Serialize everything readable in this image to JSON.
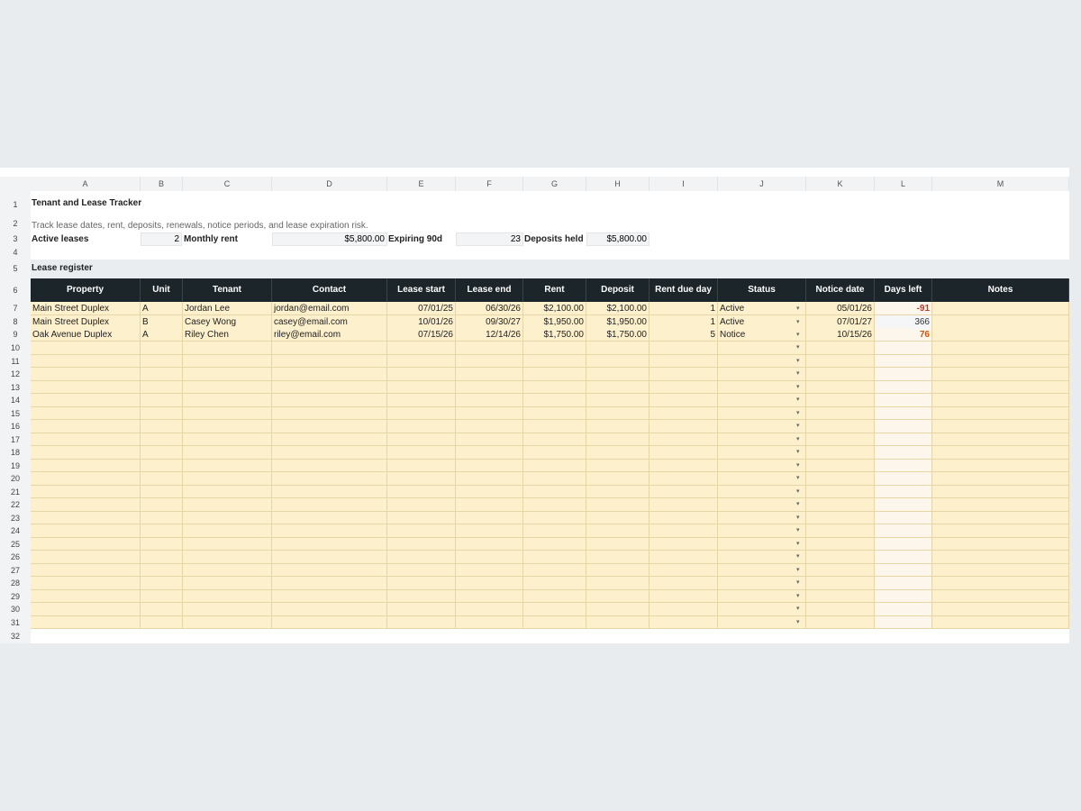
{
  "columns": [
    "A",
    "B",
    "C",
    "D",
    "E",
    "F",
    "G",
    "H",
    "I",
    "J",
    "K",
    "L",
    "M"
  ],
  "row_numbers": [
    "1",
    "2",
    "3",
    "4",
    "5",
    "6",
    "7",
    "8",
    "9",
    "10",
    "11",
    "12",
    "13",
    "14",
    "15",
    "16",
    "17",
    "18",
    "19",
    "20",
    "21",
    "22",
    "23",
    "24",
    "25",
    "26",
    "27",
    "28",
    "29",
    "30",
    "31",
    "32"
  ],
  "title": "Tenant and Lease Tracker",
  "subtitle": "Track lease dates, rent, deposits, renewals, notice periods, and lease expiration risk.",
  "summary": {
    "active_leases_label": "Active leases",
    "active_leases_value": "2",
    "monthly_rent_label": "Monthly rent",
    "monthly_rent_value": "$5,800.00",
    "expiring_label": "Expiring 90d",
    "expiring_value": "23",
    "deposits_label": "Deposits held",
    "deposits_value": "$5,800.00"
  },
  "section_title": "Lease register",
  "headers": [
    "Property",
    "Unit",
    "Tenant",
    "Contact",
    "Lease start",
    "Lease end",
    "Rent",
    "Deposit",
    "Rent due day",
    "Status",
    "Notice date",
    "Days left",
    "Notes"
  ],
  "rows": [
    {
      "property": "Main Street Duplex",
      "unit": "A",
      "tenant": "Jordan Lee",
      "contact": "jordan@email.com",
      "lease_start": "07/01/25",
      "lease_end": "06/30/26",
      "rent": "$2,100.00",
      "deposit": "$2,100.00",
      "rent_due_day": "1",
      "status": "Active",
      "notice_date": "05/01/26",
      "days_left": "-91",
      "notes": ""
    },
    {
      "property": "Main Street Duplex",
      "unit": "B",
      "tenant": "Casey Wong",
      "contact": "casey@email.com",
      "lease_start": "10/01/26",
      "lease_end": "09/30/27",
      "rent": "$1,950.00",
      "deposit": "$1,950.00",
      "rent_due_day": "1",
      "status": "Active",
      "notice_date": "07/01/27",
      "days_left": "366",
      "notes": ""
    },
    {
      "property": "Oak Avenue Duplex",
      "unit": "A",
      "tenant": "Riley Chen",
      "contact": "riley@email.com",
      "lease_start": "07/15/26",
      "lease_end": "12/14/26",
      "rent": "$1,750.00",
      "deposit": "$1,750.00",
      "rent_due_day": "5",
      "status": "Notice",
      "notice_date": "10/15/26",
      "days_left": "76",
      "notes": ""
    }
  ],
  "empty_row_count": 22,
  "dropdown_icon": "triangle-down-icon",
  "colors": {
    "header_bg": "#1c2529",
    "data_fill": "#fdf0cc",
    "negative_days": "#c0392b",
    "warning_days": "#d35400"
  }
}
